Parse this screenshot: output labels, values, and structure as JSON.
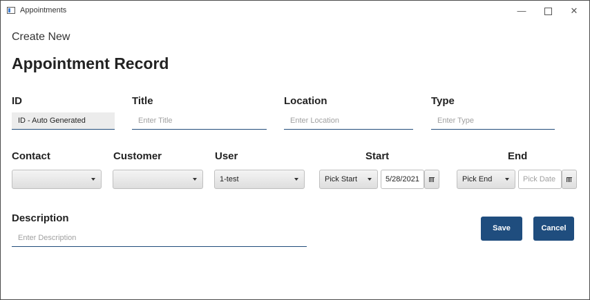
{
  "window": {
    "title": "Appointments"
  },
  "page": {
    "subtitle": "Create New",
    "heading": "Appointment Record"
  },
  "labels": {
    "id": "ID",
    "title": "Title",
    "location": "Location",
    "type": "Type",
    "contact": "Contact",
    "customer": "Customer",
    "user": "User",
    "start": "Start",
    "end": "End",
    "description": "Description"
  },
  "fields": {
    "id_value": "ID - Auto Generated",
    "title_placeholder": "Enter Title",
    "location_placeholder": "Enter Location",
    "type_placeholder": "Enter Type",
    "description_placeholder": "Enter Description"
  },
  "combos": {
    "contact": "",
    "customer": "",
    "user": "1-test",
    "start_time": "Pick Start",
    "end_time": "Pick End"
  },
  "dates": {
    "start": "5/28/2021",
    "end_placeholder": "Pick Date"
  },
  "buttons": {
    "save": "Save",
    "cancel": "Cancel"
  },
  "colors": {
    "accent": "#1f4d7e"
  },
  "icons": {
    "calendar": "calendar-icon",
    "dropdown": "chevron-down-icon"
  }
}
